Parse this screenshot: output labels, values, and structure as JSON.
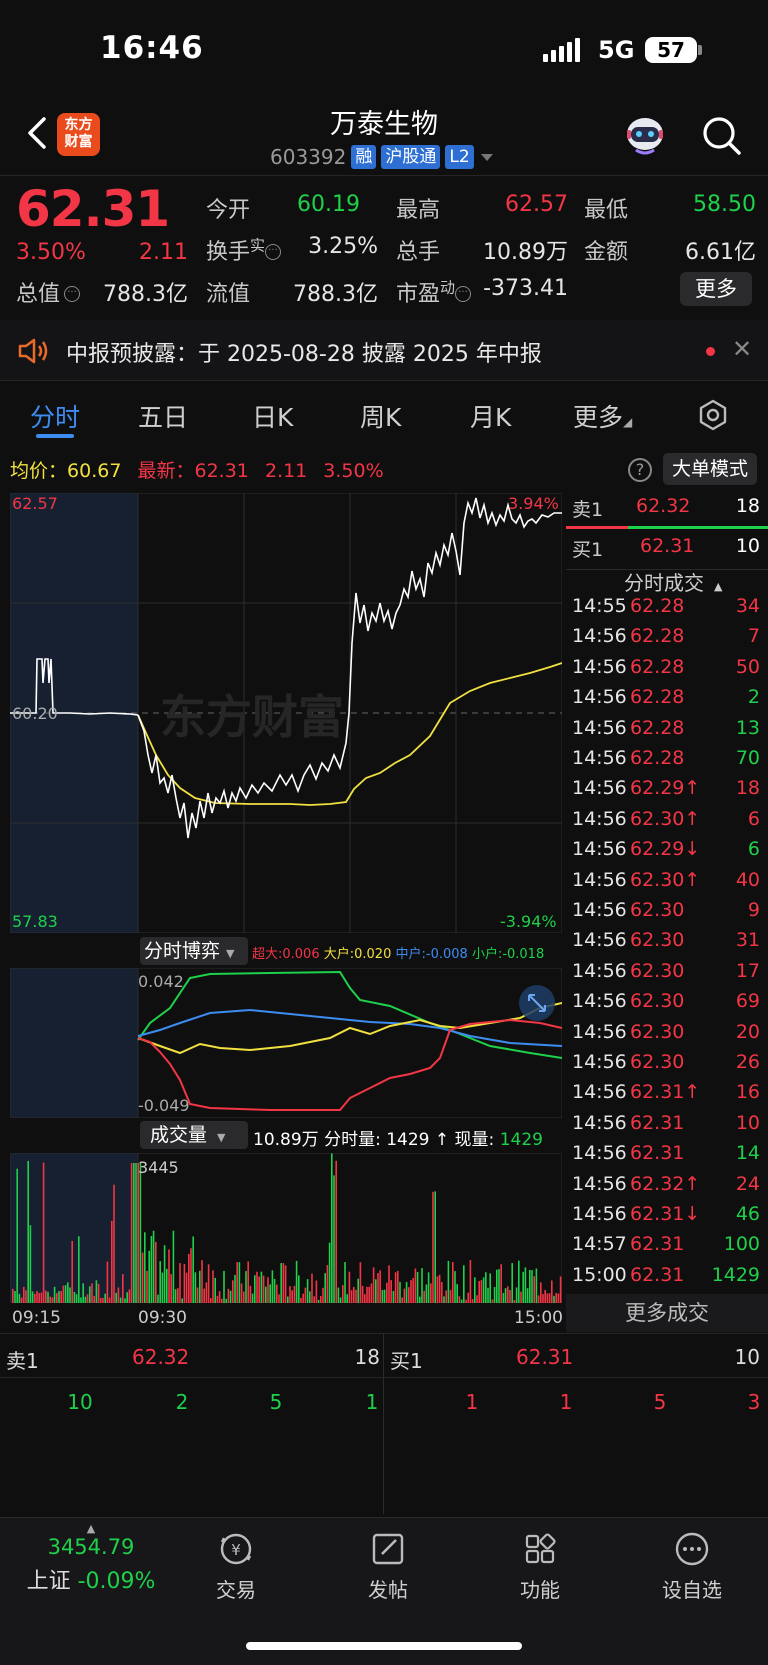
{
  "status": {
    "time": "16:46",
    "network": "5G",
    "battery": "57"
  },
  "header": {
    "name": "万泰生物",
    "code": "603392",
    "tags": [
      "融",
      "沪股通",
      "L2"
    ],
    "logo_text": "东方\n财富"
  },
  "quote": {
    "price": "62.31",
    "pct": "3.50%",
    "change": "2.11",
    "open_label": "今开",
    "open": "60.19",
    "high_label": "最高",
    "high": "62.57",
    "low_label": "最低",
    "low": "58.50",
    "turnover_label": "换手",
    "turnover_sup": "实",
    "turnover": "3.25%",
    "volume_label": "总手",
    "volume": "10.89万",
    "amount_label": "金额",
    "amount": "6.61亿",
    "mktcap_label": "总值",
    "mktcap": "788.3亿",
    "float_label": "流值",
    "float": "788.3亿",
    "pe_label": "市盈",
    "pe_sup": "动",
    "pe": "-373.41",
    "more": "更多"
  },
  "notice": {
    "text": "中报预披露：于 2025-08-28 披露 2025 年中报"
  },
  "tabs": [
    "分时",
    "五日",
    "日K",
    "周K",
    "月K",
    "更多"
  ],
  "avg_row": {
    "avg_label": "均价：",
    "avg": "60.67",
    "latest_label": "最新：",
    "latest": "62.31",
    "change": "2.11",
    "pct": "3.50%"
  },
  "big_order_mode": "大单模式",
  "chart": {
    "y_high": "62.57",
    "y_low": "57.83",
    "y_mid": "60.20",
    "pct_high": "3.94%",
    "pct_low": "-3.94%",
    "watermark": "东方财富",
    "time_start": "09:15",
    "time_open": "09:30",
    "time_end": "15:00"
  },
  "flow": {
    "title": "分时博弈",
    "legend": [
      {
        "label": "超大:0.006",
        "color": "#f23645"
      },
      {
        "label": "大户:0.020",
        "color": "#f0e040"
      },
      {
        "label": "中户:-0.008",
        "color": "#3d8cf0"
      },
      {
        "label": "小户:-0.018",
        "color": "#1fd04a"
      }
    ],
    "y_high": "0.042",
    "y_low": "-0.049"
  },
  "volume": {
    "title": "成交量",
    "total": "10.89万",
    "minute_label": "分时量:",
    "minute": "1429",
    "now_label": "现量:",
    "now": "1429",
    "y_max": "3445"
  },
  "orderbook": {
    "sell1_label": "卖1",
    "sell1_price": "62.32",
    "sell1_vol": "18",
    "buy1_label": "买1",
    "buy1_price": "62.31",
    "buy1_vol": "10"
  },
  "deals_title": "分时成交",
  "deals": [
    {
      "t": "14:55",
      "p": "62.28",
      "v": "34",
      "vc": "r"
    },
    {
      "t": "14:56",
      "p": "62.28",
      "v": "7",
      "vc": "r"
    },
    {
      "t": "14:56",
      "p": "62.28",
      "v": "50",
      "vc": "r"
    },
    {
      "t": "14:56",
      "p": "62.28",
      "v": "2",
      "vc": "g"
    },
    {
      "t": "14:56",
      "p": "62.28",
      "v": "13",
      "vc": "g"
    },
    {
      "t": "14:56",
      "p": "62.28",
      "v": "70",
      "vc": "g"
    },
    {
      "t": "14:56",
      "p": "62.29↑",
      "v": "18",
      "vc": "r"
    },
    {
      "t": "14:56",
      "p": "62.30↑",
      "v": "6",
      "vc": "r"
    },
    {
      "t": "14:56",
      "p": "62.29↓",
      "v": "6",
      "vc": "g"
    },
    {
      "t": "14:56",
      "p": "62.30↑",
      "v": "40",
      "vc": "r"
    },
    {
      "t": "14:56",
      "p": "62.30",
      "v": "9",
      "vc": "r"
    },
    {
      "t": "14:56",
      "p": "62.30",
      "v": "31",
      "vc": "r"
    },
    {
      "t": "14:56",
      "p": "62.30",
      "v": "17",
      "vc": "r"
    },
    {
      "t": "14:56",
      "p": "62.30",
      "v": "69",
      "vc": "r"
    },
    {
      "t": "14:56",
      "p": "62.30",
      "v": "20",
      "vc": "r"
    },
    {
      "t": "14:56",
      "p": "62.30",
      "v": "26",
      "vc": "r"
    },
    {
      "t": "14:56",
      "p": "62.31↑",
      "v": "16",
      "vc": "r"
    },
    {
      "t": "14:56",
      "p": "62.31",
      "v": "10",
      "vc": "r"
    },
    {
      "t": "14:56",
      "p": "62.31",
      "v": "14",
      "vc": "g"
    },
    {
      "t": "14:56",
      "p": "62.32↑",
      "v": "24",
      "vc": "r"
    },
    {
      "t": "14:56",
      "p": "62.31↓",
      "v": "46",
      "vc": "g"
    },
    {
      "t": "14:57",
      "p": "62.31",
      "v": "100",
      "vc": "g"
    },
    {
      "t": "15:00",
      "p": "62.31",
      "v": "1429",
      "vc": "g"
    }
  ],
  "more_deals": "更多成交",
  "book_bottom": {
    "sell_label": "卖1",
    "sell_price": "62.32",
    "sell_vol": "18",
    "buy_label": "买1",
    "buy_price": "62.31",
    "buy_vol": "10",
    "sell_queue": [
      "10",
      "2",
      "5",
      "1"
    ],
    "buy_queue": [
      "1",
      "1",
      "5",
      "3"
    ]
  },
  "nav": {
    "index_value": "3454.79",
    "index_name": "上证",
    "index_pct": "-0.09%",
    "items": [
      "交易",
      "发帖",
      "功能",
      "设自选"
    ]
  }
}
